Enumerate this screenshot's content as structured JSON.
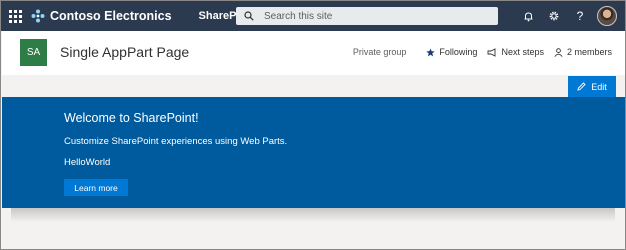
{
  "suite": {
    "brand": "Contoso Electronics",
    "app": "SharePoint",
    "search_placeholder": "Search this site",
    "icons": [
      "bell-icon",
      "gear-icon",
      "help-icon"
    ]
  },
  "site": {
    "logo_text": "SA",
    "title": "Single AppPart Page",
    "privacy": "Private group",
    "following": "Following",
    "next_steps": "Next steps",
    "members": "2 members"
  },
  "commandbar": {
    "edit": "Edit"
  },
  "hero": {
    "title": "Welcome to SharePoint!",
    "description": "Customize SharePoint experiences using Web Parts.",
    "webpart": "HelloWorld",
    "button": "Learn more"
  },
  "colors": {
    "suite_bar": "#2b3a4f",
    "site_logo": "#2e7d46",
    "hero": "#005a9e",
    "accent": "#0078d4"
  }
}
